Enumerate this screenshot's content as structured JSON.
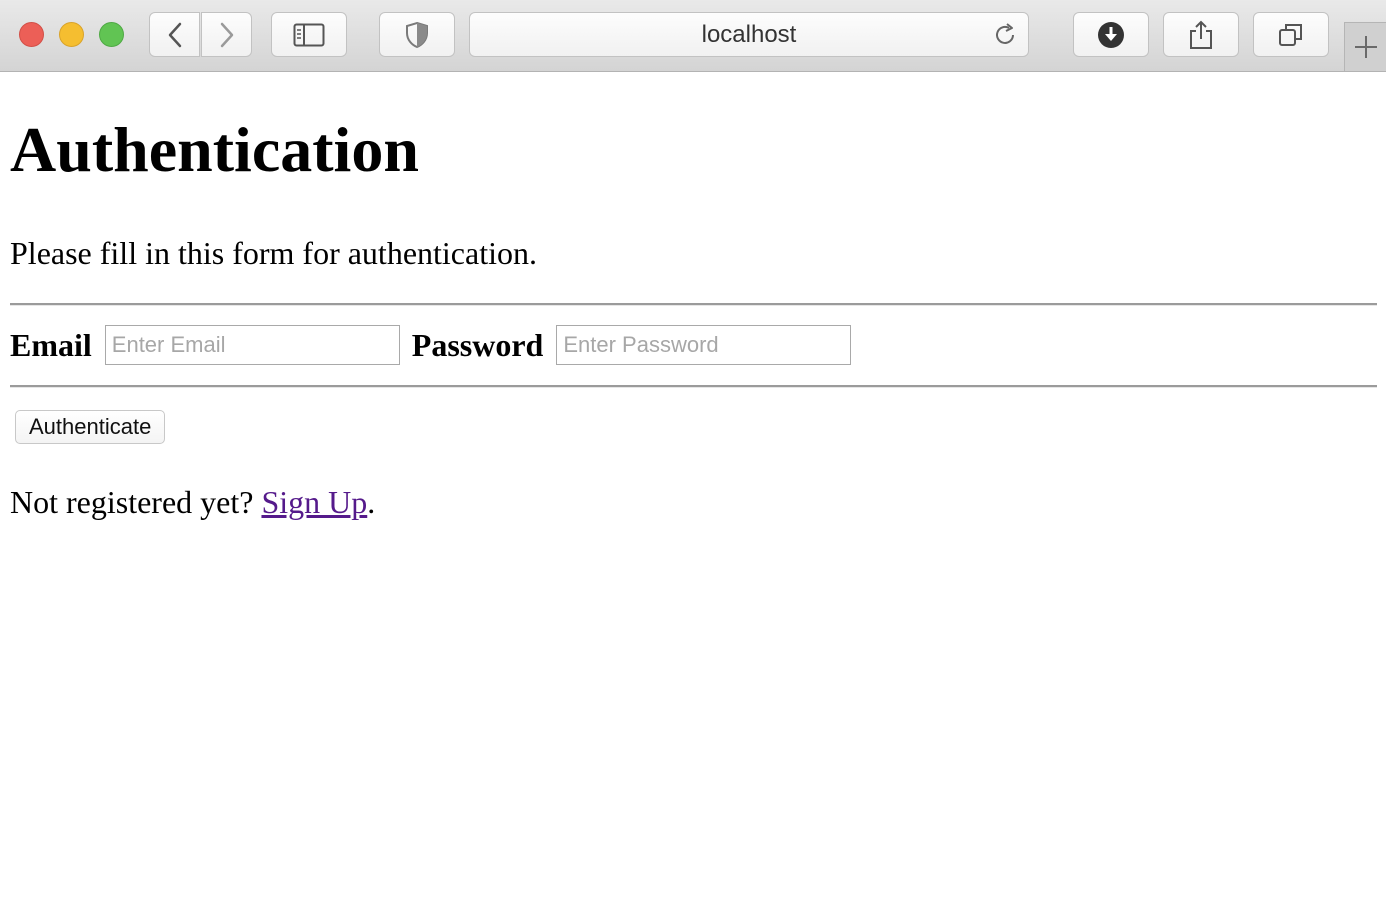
{
  "browser": {
    "url": "localhost",
    "icons": {
      "close": "close-circle",
      "minimize": "minimize-circle",
      "zoom": "zoom-circle",
      "back": "chevron-left-icon",
      "forward": "chevron-right-icon",
      "sidebar": "sidebar-icon",
      "privacy": "shield-icon",
      "reload": "reload-icon",
      "download": "download-icon",
      "share": "share-icon",
      "tabs": "tabs-icon",
      "new_tab": "plus-icon"
    }
  },
  "page": {
    "title": "Authentication",
    "intro": "Please fill in this form for authentication.",
    "form": {
      "email_label": "Email",
      "email_placeholder": "Enter Email",
      "email_value": "",
      "password_label": "Password",
      "password_placeholder": "Enter Password",
      "password_value": "",
      "submit_label": "Authenticate"
    },
    "signup": {
      "prefix": "Not registered yet? ",
      "link_text": "Sign Up",
      "suffix": "."
    },
    "colors": {
      "link_visited": "#551a8b",
      "rule": "#9b9b9b"
    }
  }
}
